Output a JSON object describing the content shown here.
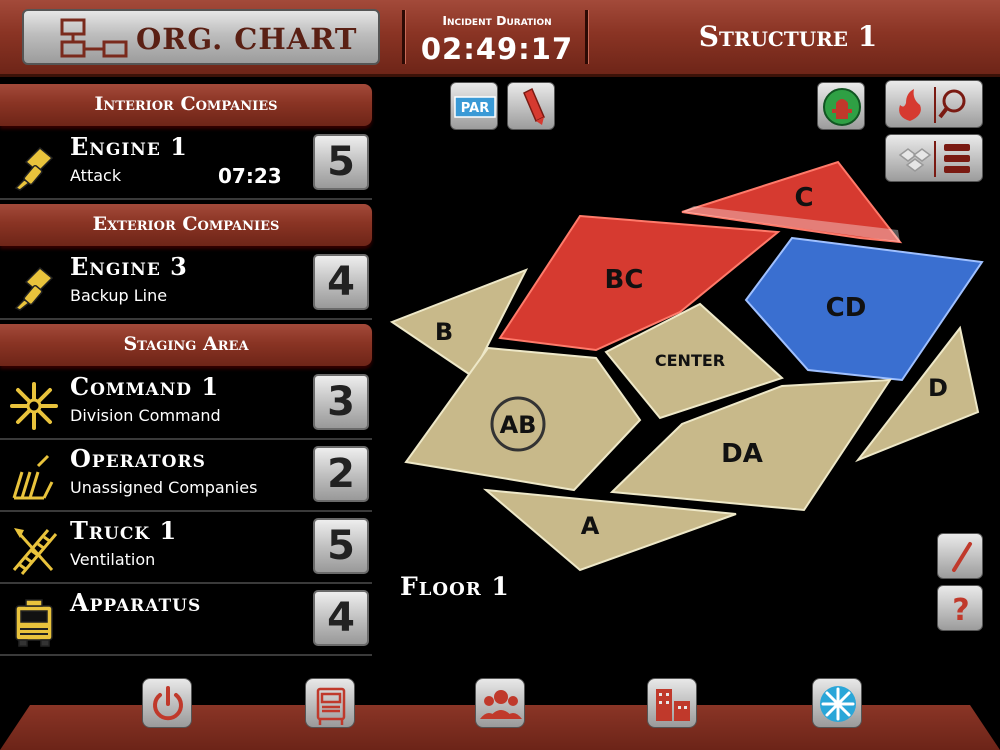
{
  "header": {
    "org_chart_label": "ORG. CHART",
    "incident_duration_label": "Incident Duration",
    "incident_duration_value": "02:49:17",
    "structure_label": "Structure 1"
  },
  "sections": {
    "interior": "Interior Companies",
    "exterior": "Exterior Companies",
    "staging": "Staging Area"
  },
  "companies": [
    {
      "name": "Engine 1",
      "sub": "Attack",
      "timer": "07:23",
      "count": "5",
      "icon": "nozzle-icon"
    },
    {
      "name": "Engine 3",
      "sub": "Backup Line",
      "timer": "",
      "count": "4",
      "icon": "nozzle-icon"
    },
    {
      "name": "Command 1",
      "sub": "Division Command",
      "timer": "",
      "count": "3",
      "icon": "command-star-icon"
    },
    {
      "name": "Operators",
      "sub": "Unassigned Companies",
      "timer": "",
      "count": "2",
      "icon": "operators-icon"
    },
    {
      "name": "Truck 1",
      "sub": "Ventilation",
      "timer": "",
      "count": "5",
      "icon": "ladder-axe-icon"
    },
    {
      "name": "Apparatus",
      "sub": "",
      "timer": "",
      "count": "4",
      "icon": "fire-truck-icon"
    }
  ],
  "toolbar": {
    "par_label": "PAR",
    "icons": [
      "par-icon",
      "marker-icon",
      "hydrant-icon",
      "fire-search-icon",
      "layers-icon"
    ]
  },
  "map": {
    "zones": {
      "c": "C",
      "bc": "BC",
      "cd": "CD",
      "b": "B",
      "center": "CENTER",
      "d": "D",
      "ab": "AB",
      "da": "DA",
      "a": "A"
    },
    "colors": {
      "tan": "#c8b98a",
      "red": "#d63a30",
      "blue": "#3a6fd0"
    },
    "floor_label": "Floor 1"
  },
  "side_tools": {
    "help_label": "?",
    "icons": [
      "pencil-icon",
      "help-icon"
    ]
  },
  "bottom_bar": {
    "icons": [
      "power-icon",
      "fire-truck-icon",
      "personnel-icon",
      "buildings-icon",
      "snowflake-icon"
    ]
  },
  "accent_colors": {
    "wood": "#8a3424",
    "silver": "#bdbdbd",
    "alert_red": "#c0392b"
  }
}
